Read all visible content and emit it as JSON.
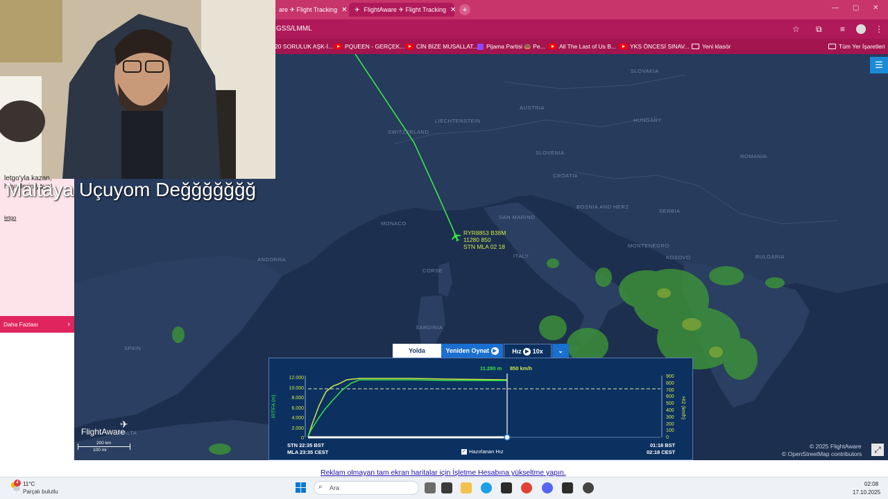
{
  "browser": {
    "tabs": [
      {
        "label": "are ✈ Flight Tracking"
      },
      {
        "label": "FlightAware ✈ Flight Tracking"
      }
    ],
    "url": "GSS/LMML",
    "bookmarks": [
      {
        "label": "20 SORULUK AŞK-İ...",
        "icon": "bookmark-icon"
      },
      {
        "label": "PQUEEN - GERÇEK...",
        "icon": "youtube-icon"
      },
      {
        "label": "CİN BİZE MUSALLAT...",
        "icon": "youtube-icon"
      },
      {
        "label": "Pijama Partisi 🍩 Pe...",
        "icon": "twitch-icon"
      },
      {
        "label": "All The Last of Us B...",
        "icon": "youtube-icon"
      },
      {
        "label": "YKS ÖNCESİ SINAV...",
        "icon": "youtube-icon"
      },
      {
        "label": "Yeni klasör",
        "icon": "folder-icon"
      }
    ],
    "all_bookmarks": "Tüm Yer İşaretleri"
  },
  "ad": {
    "text": "letgo'yla kazan, hayallerin yaya!",
    "link": "letgo",
    "more": "Daha Fazlası"
  },
  "overlay_title": "Maltaya Uçuyom Değğğğğğğ",
  "map": {
    "countries": [
      "SLOVAKIA",
      "AUSTRIA",
      "LIECHTENSTEIN",
      "HUNGARY",
      "SWITZERLAND",
      "SLOVENIA",
      "ROMANIA",
      "CROATIA",
      "SAN MARINO",
      "BOSNIA AND HERZ",
      "SERBIA",
      "MONACO",
      "ITALY",
      "MONTENEGRO",
      "KOSOVO",
      "BULGARIA",
      "ANDORRA",
      "CORSE",
      "SARDINIA",
      "SPAIN",
      "MALTA"
    ],
    "flight": {
      "callsign": "RYR8853 B38M",
      "alt_speed": "11280 850",
      "route": "STN MLA 02 18"
    }
  },
  "panel": {
    "tabs": [
      "Yolda",
      "Yeniden Oynat",
      "Hız",
      "10x"
    ],
    "current_alt": "11.280 m",
    "current_speed": "850 km/h",
    "left_axis_label": "İRTİFA (m)",
    "right_axis_label": "HIZ (km/h)",
    "left_ticks": [
      "12.000",
      "10.000",
      "8.000",
      "6.000",
      "4.000",
      "2.000",
      "0"
    ],
    "right_ticks": [
      "900",
      "800",
      "700",
      "600",
      "500",
      "400",
      "300",
      "200",
      "100",
      "0"
    ],
    "dep_label1": "STN 22:35 BST",
    "dep_label2": "MLA 23:35 CEST",
    "arr_label1": "01:18 BST",
    "arr_label2": "02:18 CEST",
    "planned_speed": "Hazırlanan Hız"
  },
  "brand": "FlightAware",
  "scale": {
    "km": "200 km",
    "mi": "100 mi"
  },
  "attribution": {
    "line1": "© 2025 FlightAware",
    "line2": "© OpenStreetMap contributors"
  },
  "banner_link": "Reklam olmayan tam ekran haritalar için İşletme Hesabına yükseltme yapın.",
  "taskbar": {
    "weather_temp": "11°C",
    "weather_desc": "Parçalı bulutlu",
    "notification_count": "4",
    "search_placeholder": "Ara",
    "time": "02:08",
    "date": "17.10.2025"
  },
  "colors": {
    "track": "#37e646",
    "chart_bg": "#0c3160",
    "accent": "#1a6fd0"
  }
}
